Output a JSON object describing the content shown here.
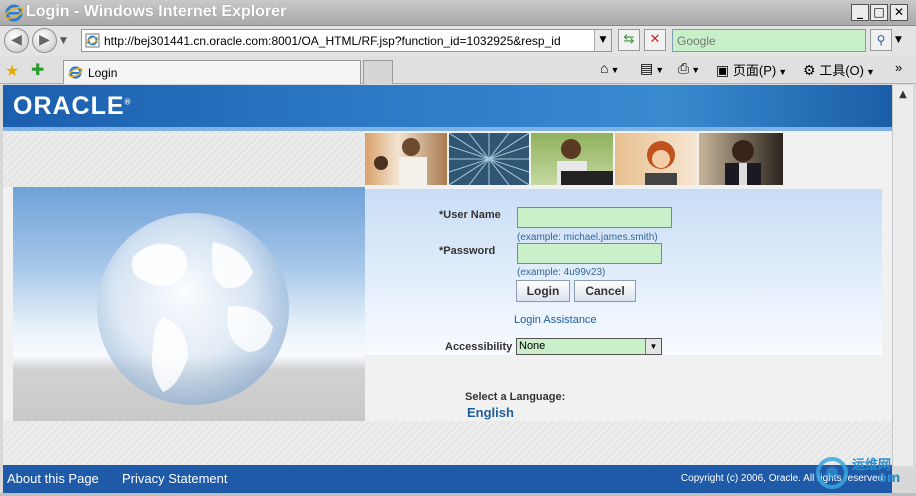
{
  "window": {
    "title": "Login - Windows Internet Explorer",
    "buttons": {
      "minimize": "_",
      "maximize": "□",
      "close": "✕"
    }
  },
  "address_bar": {
    "url": "http://bej301441.cn.oracle.com:8001/OA_HTML/RF.jsp?function_id=1032925&resp_id",
    "search_placeholder": "Google"
  },
  "tabs": [
    {
      "label": "Login"
    }
  ],
  "command_bar": {
    "page_label": "页面(P)",
    "tools_label": "工具(O)"
  },
  "oracle": {
    "logo": "ORACLE"
  },
  "login_form": {
    "username_label": "*User Name",
    "username_value": "",
    "username_hint": "(example: michael.james.smith)",
    "password_label": "*Password",
    "password_value": "",
    "password_hint": "(example: 4u99v23)",
    "login_button": "Login",
    "cancel_button": "Cancel",
    "login_assistance": "Login Assistance",
    "accessibility_label": "Accessibility",
    "accessibility_value": "None"
  },
  "language": {
    "label": "Select a Language:",
    "option": "English"
  },
  "footer": {
    "about": "About this Page",
    "privacy": "Privacy Statement",
    "copyright": "Copyright (c) 2006, Oracle. All rights reserved."
  },
  "watermark": {
    "text_cn": "运维网",
    "text_en": "om"
  },
  "colors": {
    "oracle_blue": "#1e5aa8",
    "field_green": "#c9f0c9",
    "link_blue": "#1f5e9e"
  }
}
